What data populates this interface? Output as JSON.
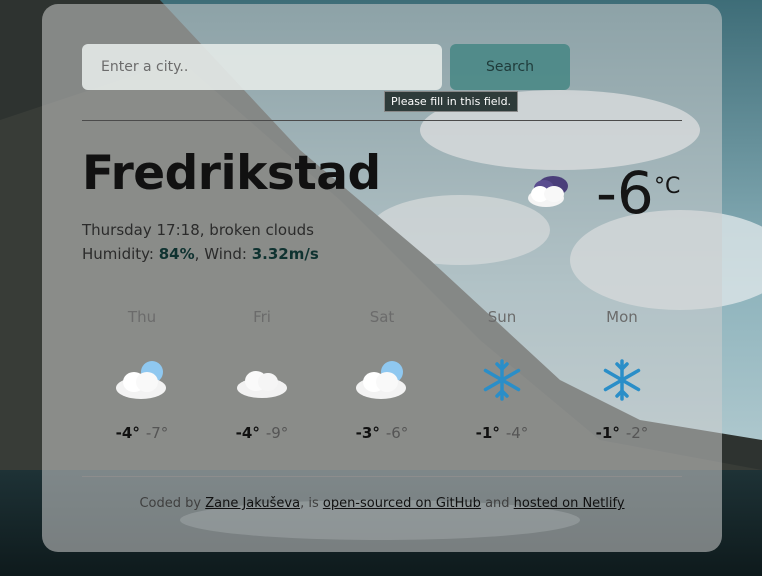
{
  "search": {
    "placeholder": "Enter a city..",
    "button_label": "Search",
    "tooltip": "Please fill in this field."
  },
  "current": {
    "city": "Fredrikstad",
    "day_time": "Thursday 17:18",
    "description": "broken clouds",
    "humidity_label": "Humidity: ",
    "humidity": "84%",
    "wind_label": "Wind: ",
    "wind": "3.32m/s",
    "temperature": "-6",
    "unit": "°C",
    "icon": "broken-clouds-icon"
  },
  "forecast": [
    {
      "day": "Thu",
      "max": "-4°",
      "min": "-7°",
      "icon": "sun-cloud-icon"
    },
    {
      "day": "Fri",
      "max": "-4°",
      "min": "-9°",
      "icon": "cloud-icon"
    },
    {
      "day": "Sat",
      "max": "-3°",
      "min": "-6°",
      "icon": "sun-cloud-icon"
    },
    {
      "day": "Sun",
      "max": "-1°",
      "min": "-4°",
      "icon": "snowflake-icon"
    },
    {
      "day": "Mon",
      "max": "-1°",
      "min": "-2°",
      "icon": "snowflake-icon"
    }
  ],
  "footer": {
    "prefix": "Coded by ",
    "author": "Zane Jakuševa",
    "middle": ", is ",
    "github_link": "open-sourced on GitHub",
    "and": " and ",
    "netlify_link": "hosted on Netlify"
  },
  "colors": {
    "accent": "#458684",
    "card_bg": "rgba(205,205,205,0.55)"
  }
}
